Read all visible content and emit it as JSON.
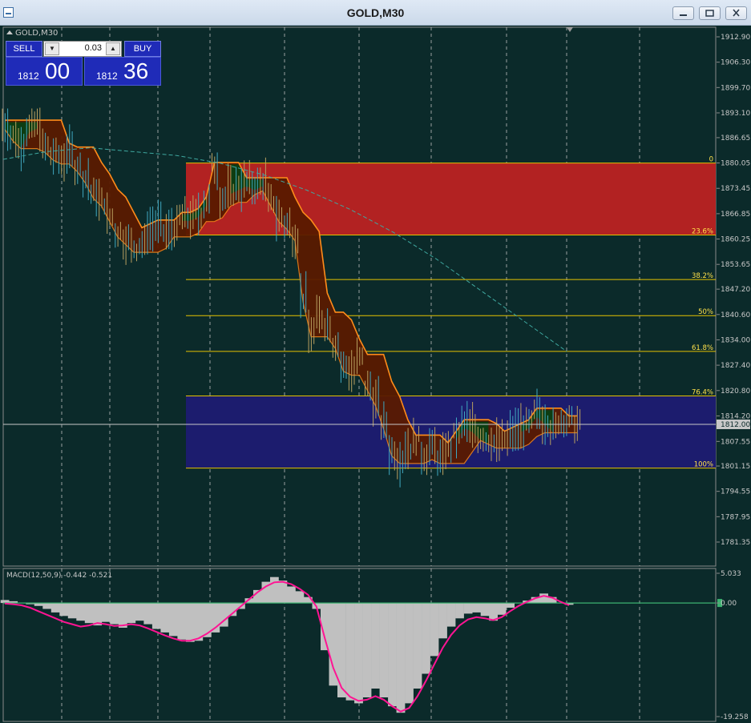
{
  "window": {
    "title": "GOLD,M30",
    "symbol_label": "GOLD,M30"
  },
  "trade_panel": {
    "sell_label": "SELL",
    "buy_label": "BUY",
    "lot_value": "0.03",
    "bid_main": "1812",
    "bid_pips": "00",
    "ask_main": "1812",
    "ask_pips": "36"
  },
  "chart_data": [
    {
      "type": "line",
      "symbol": "GOLD",
      "timeframe": "M30",
      "ylim": [
        1781.35,
        1912.9
      ],
      "y_ticks": [
        "1912.90",
        "1906.30",
        "1899.70",
        "1893.10",
        "1886.65",
        "1880.05",
        "1873.45",
        "1866.85",
        "1860.25",
        "1853.65",
        "1847.20",
        "1840.60",
        "1834.00",
        "1827.40",
        "1820.80",
        "1814.20",
        "1807.55",
        "1801.15",
        "1794.55",
        "1787.95",
        "1781.35"
      ],
      "current_price": "1812.00",
      "price_series": [
        1890,
        1887,
        1885,
        1889,
        1890,
        1884,
        1882,
        1881,
        1883,
        1879,
        1876,
        1872,
        1870,
        1866,
        1862,
        1860,
        1858,
        1859,
        1863,
        1864,
        1862,
        1863,
        1866,
        1866,
        1867,
        1870,
        1879,
        1871,
        1873,
        1874,
        1875,
        1874,
        1875,
        1870,
        1866,
        1864,
        1861,
        1845,
        1836,
        1840,
        1838,
        1833,
        1827,
        1826,
        1829,
        1822,
        1818,
        1812,
        1805,
        1803,
        1806,
        1808,
        1804,
        1806,
        1803,
        1806,
        1809,
        1812,
        1811,
        1809,
        1808,
        1807,
        1808,
        1810,
        1811,
        1812,
        1815,
        1813,
        1811,
        1813,
        1813,
        1812
      ],
      "fibonacci_levels": [
        {
          "label": "0",
          "value": 1880.05
        },
        {
          "label": "23.6%",
          "value": 1861.3
        },
        {
          "label": "38.2%",
          "value": 1849.7
        },
        {
          "label": "50%",
          "value": 1840.3
        },
        {
          "label": "61.8%",
          "value": 1831.0
        },
        {
          "label": "76.4%",
          "value": 1819.4
        },
        {
          "label": "100%",
          "value": 1800.6
        }
      ],
      "colors": {
        "upper_zone": "#b22222",
        "lower_zone": "#1c1c6e",
        "fib_line": "#e6c200",
        "cloud_bearish": "#5a1a00",
        "cloud_bullish": "#0d3d12",
        "cloud_edge": "#ff8c1a",
        "moving_average": "#3fa8a0",
        "price_bars": "#3fa8c0",
        "grid": "#c8c8c8"
      }
    },
    {
      "type": "bar",
      "indicator_label": "MACD(12,50,9) -0.442 -0.521",
      "ylim": [
        -19.258,
        5.033
      ],
      "y_ticks": [
        "5.033",
        "0.00",
        "-19.258"
      ],
      "histogram": [
        0.5,
        0.3,
        0.0,
        -0.2,
        -0.5,
        -1.0,
        -1.6,
        -2.2,
        -2.6,
        -3.0,
        -3.4,
        -3.8,
        -3.2,
        -3.6,
        -4.2,
        -3.4,
        -3.0,
        -3.6,
        -4.4,
        -5.0,
        -5.6,
        -6.2,
        -6.6,
        -6.4,
        -5.8,
        -5.0,
        -4.0,
        -2.2,
        -1.0,
        0.8,
        2.2,
        3.6,
        4.4,
        3.8,
        2.8,
        2.0,
        1.0,
        -1.0,
        -8.0,
        -14.0,
        -16.0,
        -16.5,
        -17.0,
        -16.0,
        -14.5,
        -16.0,
        -17.5,
        -18.6,
        -17.0,
        -14.5,
        -12.0,
        -9.0,
        -6.0,
        -4.0,
        -2.6,
        -1.8,
        -1.6,
        -2.2,
        -3.0,
        -2.0,
        -0.8,
        0.0,
        0.4,
        1.0,
        1.6,
        1.0,
        0.0,
        -0.3
      ],
      "signal": [
        -0.1,
        -0.2,
        -0.4,
        -0.8,
        -1.4,
        -2.0,
        -2.6,
        -3.2,
        -3.6,
        -4.0,
        -3.8,
        -3.4,
        -3.6,
        -3.9,
        -3.8,
        -3.6,
        -3.8,
        -4.3,
        -4.9,
        -5.5,
        -6.0,
        -6.4,
        -6.4,
        -6.0,
        -5.2,
        -4.2,
        -3.0,
        -1.8,
        -0.6,
        0.6,
        1.8,
        2.8,
        3.5,
        3.6,
        3.2,
        2.4,
        1.4,
        -0.6,
        -6.0,
        -11.0,
        -14.4,
        -15.9,
        -16.6,
        -16.4,
        -15.8,
        -16.4,
        -17.5,
        -18.4,
        -17.8,
        -15.8,
        -13.2,
        -10.4,
        -7.6,
        -5.4,
        -3.8,
        -2.8,
        -2.4,
        -2.6,
        -2.9,
        -2.4,
        -1.4,
        -0.5,
        0.2,
        0.8,
        1.2,
        0.9,
        0.2,
        -0.4
      ],
      "colors": {
        "histogram": "#c0c0c0",
        "signal": "#ff1493",
        "zero_line": "#3cb371"
      }
    }
  ]
}
